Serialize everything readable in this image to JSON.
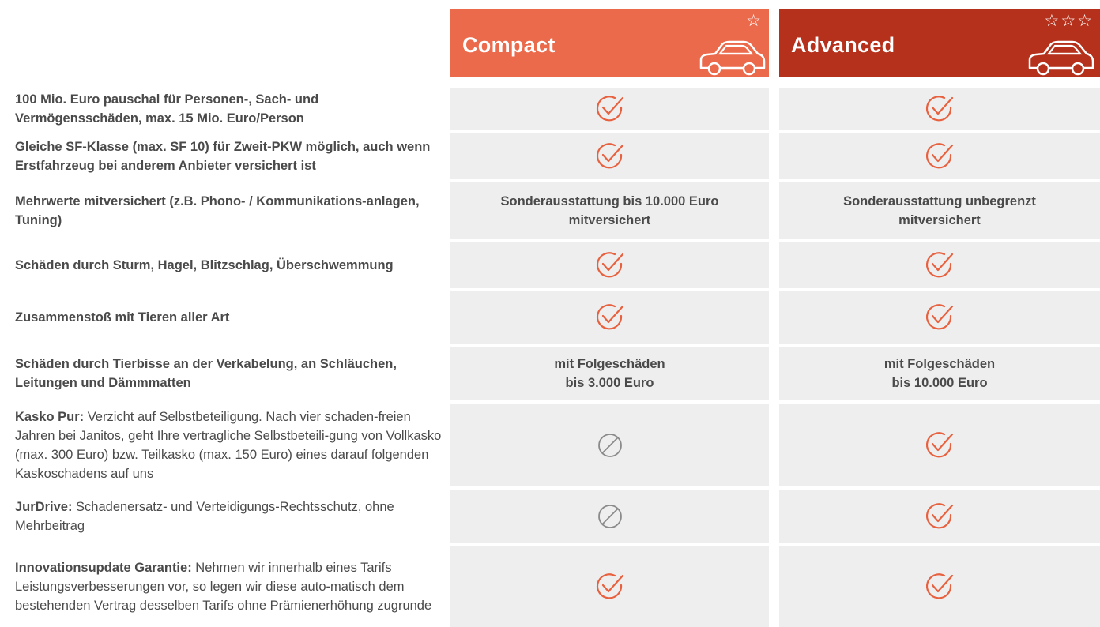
{
  "header": {
    "compact": {
      "name": "Compact",
      "stars": "☆",
      "star_count": 1
    },
    "advanced": {
      "name": "Advanced",
      "stars": "☆☆☆",
      "star_count": 3
    }
  },
  "colors": {
    "compact": "#ec6a4c",
    "advanced": "#b5311b",
    "cell_bg": "#eeeeee",
    "check": "#e8613f",
    "none": "#8a8a8a"
  },
  "rows": [
    {
      "label_bold": "100 Mio. Euro pauschal für Personen-, Sach- und Vermögensschäden, max. 15 Mio. Euro/Person",
      "label_rest": "",
      "compact": {
        "type": "check-icon"
      },
      "advanced": {
        "type": "check-icon"
      }
    },
    {
      "label_bold": "Gleiche SF-Klasse (max. SF 10) für Zweit-PKW möglich, auch wenn Erstfahrzeug bei anderem Anbieter versichert ist",
      "label_rest": "",
      "compact": {
        "type": "check-icon"
      },
      "advanced": {
        "type": "check-icon"
      }
    },
    {
      "label_bold": "Mehrwerte mitversichert (z.B. Phono- / Kommunikations-anlagen, Tuning)",
      "label_rest": "",
      "compact": {
        "type": "text",
        "line1": "Sonderausstattung bis 10.000 Euro",
        "line2": "mitversichert"
      },
      "advanced": {
        "type": "text",
        "line1": "Sonderausstattung unbegrenzt",
        "line2": "mitversichert"
      }
    },
    {
      "label_bold": "Schäden durch Sturm, Hagel, Blitzschlag, Überschwemmung",
      "label_rest": "",
      "compact": {
        "type": "check-icon"
      },
      "advanced": {
        "type": "check-icon"
      }
    },
    {
      "label_bold": "Zusammenstoß mit Tieren aller Art",
      "label_rest": "",
      "compact": {
        "type": "check-icon"
      },
      "advanced": {
        "type": "check-icon"
      }
    },
    {
      "label_bold": "Schäden durch Tierbisse an der Verkabelung, an Schläuchen, Leitungen und Dämmmatten",
      "label_rest": "",
      "compact": {
        "type": "text",
        "line1": "mit Folgeschäden",
        "line2": "bis 3.000 Euro"
      },
      "advanced": {
        "type": "text",
        "line1": "mit Folgeschäden",
        "line2": "bis 10.000 Euro"
      }
    },
    {
      "label_bold": "Kasko Pur:",
      "label_rest": " Verzicht auf Selbstbeteiligung. Nach vier schaden-freien Jahren bei Janitos, geht Ihre vertragliche Selbstbeteili-gung von Vollkasko (max. 300 Euro) bzw. Teilkasko (max. 150 Euro) eines darauf folgenden Kaskoschadens auf uns",
      "compact": {
        "type": "not-included-icon"
      },
      "advanced": {
        "type": "check-icon"
      }
    },
    {
      "label_bold": "JurDrive:",
      "label_rest": " Schadenersatz- und Verteidigungs-Rechtsschutz, ohne Mehrbeitrag",
      "compact": {
        "type": "not-included-icon"
      },
      "advanced": {
        "type": "check-icon"
      }
    },
    {
      "label_bold": "Innovationsupdate Garantie:",
      "label_rest": " Nehmen wir innerhalb eines Tarifs Leistungsverbesserungen vor, so legen wir diese auto-matisch dem bestehenden Vertrag desselben Tarifs ohne Prämienerhöhung zugrunde",
      "compact": {
        "type": "check-icon"
      },
      "advanced": {
        "type": "check-icon"
      }
    }
  ]
}
